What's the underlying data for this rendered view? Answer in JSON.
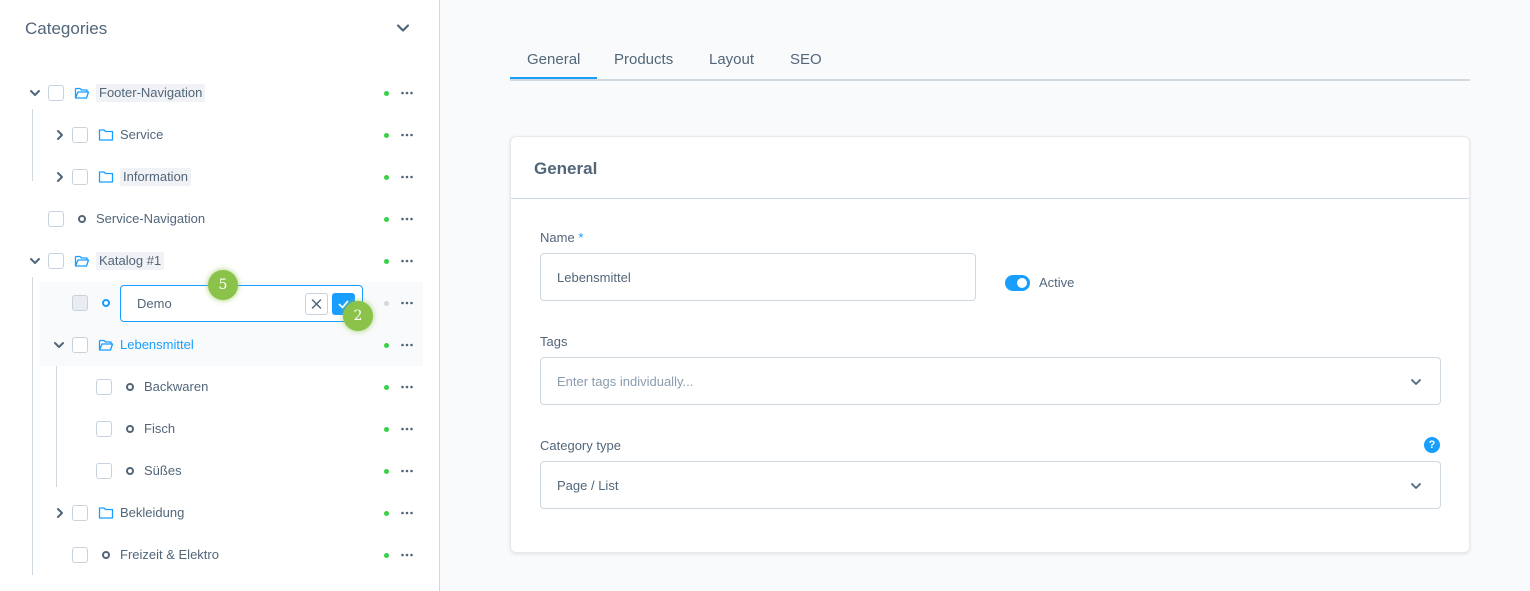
{
  "sidebar": {
    "title": "Categories",
    "tree": [
      {
        "label": "Footer-Navigation"
      },
      {
        "label": "Service"
      },
      {
        "label": "Information"
      },
      {
        "label": "Service-Navigation"
      },
      {
        "label": "Katalog #1"
      },
      {
        "label": "Demo"
      },
      {
        "label": "Lebensmittel"
      },
      {
        "label": "Backwaren"
      },
      {
        "label": "Fisch"
      },
      {
        "label": "Süßes"
      },
      {
        "label": "Bekleidung"
      },
      {
        "label": "Freizeit & Elektro"
      }
    ],
    "callouts": [
      "5",
      "2"
    ]
  },
  "tabs": [
    "General",
    "Products",
    "Layout",
    "SEO"
  ],
  "active_tab": "General",
  "card": {
    "title": "General",
    "name_label": "Name",
    "required_mark": "*",
    "name_value": "Lebensmittel",
    "active_label": "Active",
    "active": true,
    "tags_label": "Tags",
    "tags_placeholder": "Enter tags individually...",
    "type_label": "Category type",
    "type_value": "Page / List",
    "help_glyph": "?"
  },
  "colors": {
    "accent": "#189eff",
    "status_active": "#37d046",
    "status_inactive": "#d1d9e0",
    "callout": "#8bc34a",
    "text": "#52667a"
  },
  "icons": [
    "chevron-down-icon",
    "chevron-right-icon",
    "folder-icon",
    "folder-open-icon",
    "category-dot-icon",
    "more-icon",
    "close-icon",
    "check-icon",
    "help-icon"
  ]
}
